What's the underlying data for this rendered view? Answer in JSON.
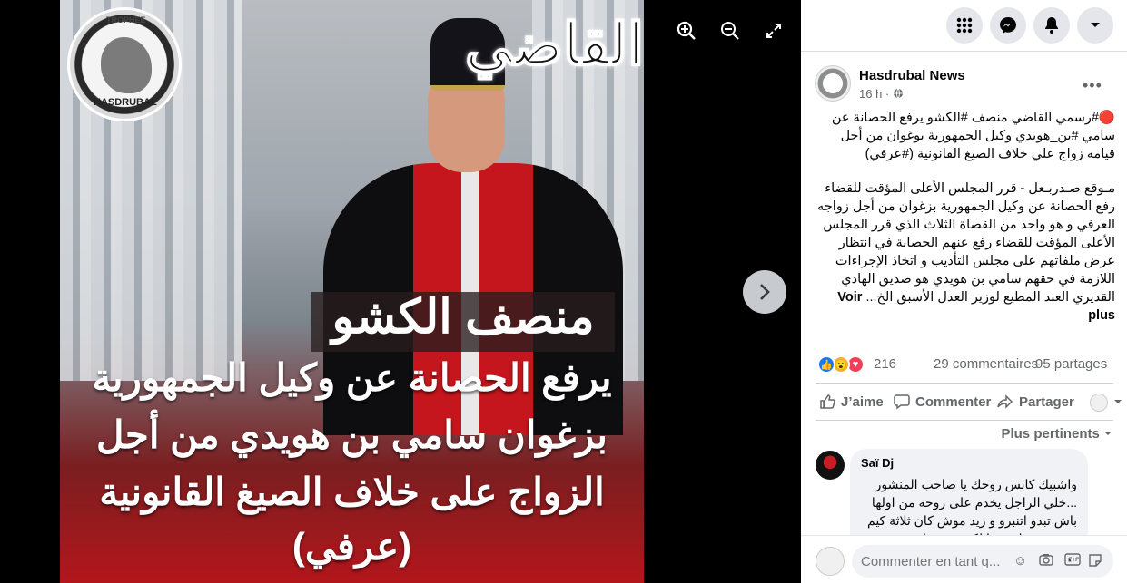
{
  "media": {
    "image_title": "القاضي",
    "image_name": "منصف الكشو",
    "headline_lines": [
      "يرفع الحصانة عن وكيل الجمهورية",
      "بزغوان سامي بن هويدي من أجل",
      "الزواج على خلاف الصيغ القانونية",
      "(عرفي)"
    ],
    "logo_text_top": "TROPHEE",
    "logo_text_bottom": "HASDRUBAL",
    "zoom_in_icon": "zoom-in-icon",
    "zoom_out_icon": "zoom-out-icon",
    "fullscreen_icon": "fullscreen-icon",
    "next_icon": "chevron-right-icon"
  },
  "topbar": {
    "icons": [
      "menu-grid-icon",
      "messenger-icon",
      "notifications-icon",
      "account-chevron-icon"
    ]
  },
  "post": {
    "author": "Hasdrubal News",
    "time": "16 h ·",
    "paragraph1": "🔴#رسمي القاضي منصف #الكشو يرفع الحصانة عن سامي #بن_هويدي وكيل الجمهورية بوغوان من أجل قيامه زواج علي خلاف الصيغ القانونية (#عرفي)",
    "paragraph2": "مـوقع صـدربـعل - قرر المجلس الأعلى المؤقت للقضاء رفع الحصانة عن وكيل الجمهورية بزغوان من أجل زواجه العرفي و هو واحد من القضاة الثلاث الذي قرر المجلس الأعلى المؤقت للقضاء رفع عنهم الحصانة في انتظار عرض ملفاتهم على مجلس التأديب و اتخاذ الإجراءات اللازمة في حقهم سامي بن هويدي هو صديق الهادي القديري العبد المطيع لوزير العدل الأسبق الخ...",
    "see_more": "Voir plus",
    "reaction_count": "216",
    "comments_count": "29 commentaires",
    "shares_count": "95 partages",
    "like_label": "J’aime",
    "comment_label": "Commenter",
    "share_label": "Partager",
    "sort_label": "Plus pertinents"
  },
  "comment": {
    "author": "Saï Dj",
    "text": "واشبيك كابس روحك يا صاحب المنشور ...خلي الراجل يخدم على روحه من اولها باش تبدو اتنبرو و زيد موش كان ثلاثة كيم عندهم مصاب وما لكن منهم باش"
  },
  "composer": {
    "placeholder": "Commenter en tant q..."
  },
  "colors": {
    "facebook_blue": "#1877f2",
    "red_banner": "#b3161b",
    "panel_bg": "#ffffff"
  }
}
